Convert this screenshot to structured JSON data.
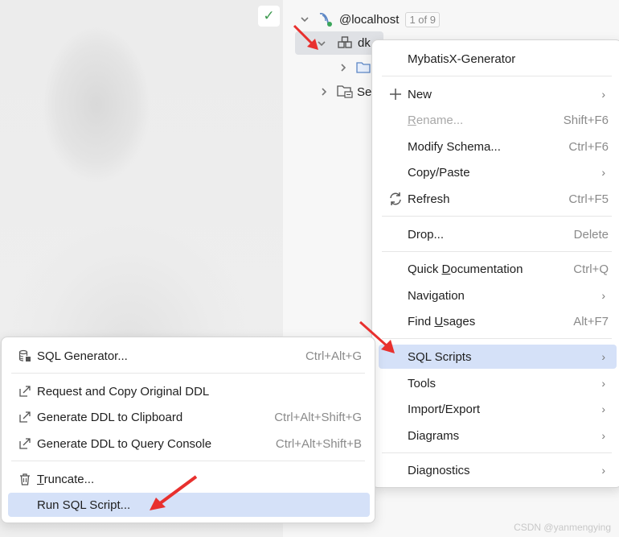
{
  "tree": {
    "host_label": "@localhost",
    "count_badge": "1 of 9",
    "db_label": "dk",
    "folder2_label": "Se"
  },
  "main_menu": {
    "items": [
      {
        "label": "MybatisX-Generator",
        "shortcut": "",
        "icon": "",
        "submenu": false
      },
      {
        "label": "New",
        "shortcut": "",
        "icon": "plus-icon",
        "submenu": true
      },
      {
        "label": "Rename...",
        "shortcut": "Shift+F6",
        "icon": "",
        "submenu": false,
        "disabled": true
      },
      {
        "label": "Modify Schema...",
        "shortcut": "Ctrl+F6",
        "icon": "",
        "submenu": false
      },
      {
        "label": "Copy/Paste",
        "shortcut": "",
        "icon": "",
        "submenu": true
      },
      {
        "label": "Refresh",
        "shortcut": "Ctrl+F5",
        "icon": "refresh-icon",
        "submenu": false
      },
      {
        "label": "Drop...",
        "shortcut": "Delete",
        "icon": "",
        "submenu": false
      },
      {
        "label": "Quick Documentation",
        "shortcut": "Ctrl+Q",
        "icon": "",
        "submenu": false
      },
      {
        "label": "Navigation",
        "shortcut": "",
        "icon": "",
        "submenu": true
      },
      {
        "label": "Find Usages",
        "shortcut": "Alt+F7",
        "icon": "",
        "submenu": false
      },
      {
        "label": "SQL Scripts",
        "shortcut": "",
        "icon": "",
        "submenu": true,
        "selected": true
      },
      {
        "label": "Tools",
        "shortcut": "",
        "icon": "",
        "submenu": true
      },
      {
        "label": "Import/Export",
        "shortcut": "",
        "icon": "",
        "submenu": true
      },
      {
        "label": "Diagrams",
        "shortcut": "",
        "icon": "",
        "submenu": true
      },
      {
        "label": "Diagnostics",
        "shortcut": "",
        "icon": "",
        "submenu": true
      }
    ]
  },
  "sub_menu": {
    "items": [
      {
        "label": "SQL Generator...",
        "shortcut": "Ctrl+Alt+G",
        "icon": "database-icon"
      },
      {
        "label": "Request and Copy Original DDL",
        "shortcut": "",
        "icon": "external-link-icon"
      },
      {
        "label": "Generate DDL to Clipboard",
        "shortcut": "Ctrl+Alt+Shift+G",
        "icon": "external-link-icon"
      },
      {
        "label": "Generate DDL to Query Console",
        "shortcut": "Ctrl+Alt+Shift+B",
        "icon": "external-link-icon"
      },
      {
        "label": "Truncate...",
        "shortcut": "",
        "icon": "trash-icon"
      },
      {
        "label": "Run SQL Script...",
        "shortcut": "",
        "icon": "",
        "selected": true
      }
    ]
  },
  "watermark": "CSDN @yanmengying",
  "colors": {
    "selection": "#d5e1f8",
    "annotation_arrow": "#e8302e",
    "check": "#3d9a4f"
  }
}
